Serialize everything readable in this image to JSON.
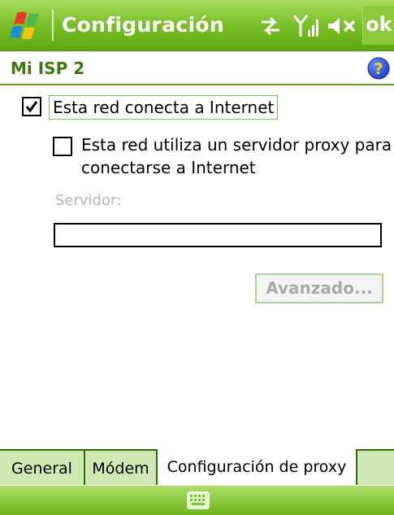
{
  "window": {
    "title": "Configuración",
    "ok_label": "ok"
  },
  "page": {
    "title": "Mi ISP 2"
  },
  "options": {
    "internet_label": "Esta red conecta a Internet",
    "internet_checked": true,
    "proxy_line1": "Esta red utiliza un servidor proxy para",
    "proxy_line2": "conectarse a Internet",
    "proxy_checked": false
  },
  "server": {
    "label": "Servidor:",
    "value": ""
  },
  "advanced_label": "Avanzado...",
  "tabs": [
    {
      "label": "General",
      "active": false
    },
    {
      "label": "Módem",
      "active": false
    },
    {
      "label": "Configuración de proxy",
      "active": true
    }
  ],
  "icons": {
    "start": "windows-flag-icon",
    "connectivity": "data-connection-icon",
    "signal": "signal-strength-icon",
    "volume": "speaker-muted-icon",
    "help": "help-icon",
    "keyboard": "keyboard-icon"
  },
  "colors": {
    "bar_green": "#7cc12b",
    "title_green": "#3d7a0d",
    "help_blue": "#1f44c9"
  }
}
